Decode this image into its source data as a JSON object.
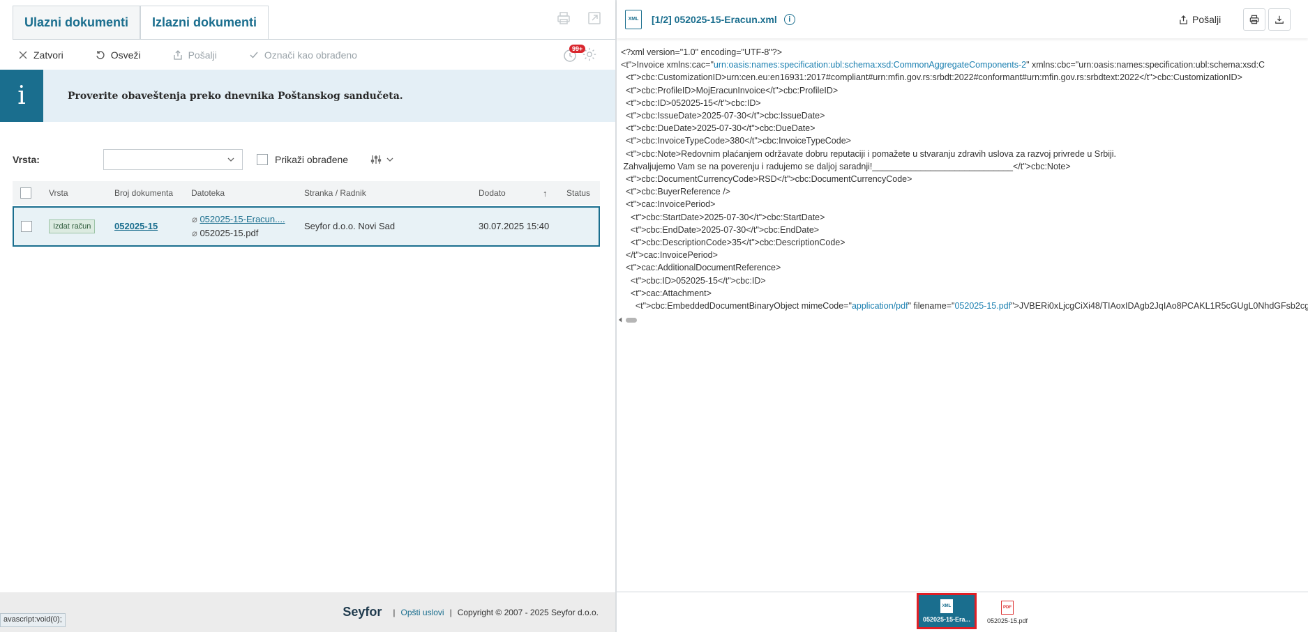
{
  "tabs": [
    {
      "label": "Ulazni dokumenti"
    },
    {
      "label": "Izlazni dokumenti"
    }
  ],
  "toolbar": {
    "close_label": "Zatvori",
    "refresh_label": "Osveži",
    "send_label": "Pošalji",
    "mark_processed_label": "Označi kao obrađeno",
    "badge": "99+"
  },
  "info": {
    "icon": "i",
    "message": "Proverite obaveštenja preko dnevnika Poštanskog sandučeta."
  },
  "filter": {
    "type_label": "Vrsta:",
    "type_value": "",
    "show_processed_label": "Prikaži obrađene"
  },
  "table": {
    "headers": [
      "Vrsta",
      "Broj dokumenta",
      "Datoteka",
      "Stranka / Radnik",
      "Dodato",
      "Status"
    ],
    "sort_icon": "↑",
    "rows": [
      {
        "type": "Izdat račun",
        "doc_number": "052025-15",
        "file1": "052025-15-Eracun....",
        "file2": "052025-15.pdf",
        "party": "Seyfor d.o.o. Novi Sad",
        "added": "30.07.2025 15:40",
        "status": ""
      }
    ]
  },
  "footer": {
    "brand": "Seyfor",
    "terms": "Opšti uslovi",
    "copyright": "Copyright © 2007 - 2025 Seyfor d.o.o."
  },
  "statusbar": "avascript:void(0);",
  "viewer": {
    "file_icon_label": "XML",
    "title": "[1/2] 052025-15-Eracun.xml",
    "send_label": "Pošalji",
    "xml_lines": [
      "<?xml version=\"1.0\" encoding=\"UTF-8\"?>",
      "<Invoice xmlns:cac=\"urn:oasis:names:specification:ubl:schema:xsd:CommonAggregateComponents-2\" xmlns:cbc=\"urn:oasis:names:specification:ubl:schema:xsd:C",
      "  <cbc:CustomizationID>urn:cen.eu:en16931:2017#compliant#urn:mfin.gov.rs:srbdt:2022#conformant#urn:mfin.gov.rs:srbdtext:2022</cbc:CustomizationID>",
      "  <cbc:ProfileID>MojEracunInvoice</cbc:ProfileID>",
      "  <cbc:ID>052025-15</cbc:ID>",
      "  <cbc:IssueDate>2025-07-30</cbc:IssueDate>",
      "  <cbc:DueDate>2025-07-30</cbc:DueDate>",
      "  <cbc:InvoiceTypeCode>380</cbc:InvoiceTypeCode>",
      "  <cbc:Note>Redovnim plaćanjem održavate dobru reputaciji i pomažete u stvaranju zdravih uslova za razvoj privrede u Srbiji.",
      " Zahvaljujemo Vam se na poverenju i radujemo se daljoj saradnji!_____________________________</cbc:Note>",
      "  <cbc:DocumentCurrencyCode>RSD</cbc:DocumentCurrencyCode>",
      "  <cbc:BuyerReference />",
      "  <cac:InvoicePeriod>",
      "    <cbc:StartDate>2025-07-30</cbc:StartDate>",
      "    <cbc:EndDate>2025-07-30</cbc:EndDate>",
      "    <cbc:DescriptionCode>35</cbc:DescriptionCode>",
      "  </cac:InvoicePeriod>",
      "  <cac:AdditionalDocumentReference>",
      "    <cbc:ID>052025-15</cbc:ID>",
      "    <cac:Attachment>",
      "      <cbc:EmbeddedDocumentBinaryObject mimeCode=\"application/pdf\" filename=\"052025-15.pdf\">JVBERi0xLjcgCiXi48/TIAoxIDAgb2JqIAo8PCAKL1R5cGUgL0NhdGFsb2cg"
    ],
    "attachments": [
      {
        "icon": "XML",
        "label": "052025-15-Era..."
      },
      {
        "icon": "PDF",
        "label": "052025-15.pdf"
      }
    ]
  }
}
